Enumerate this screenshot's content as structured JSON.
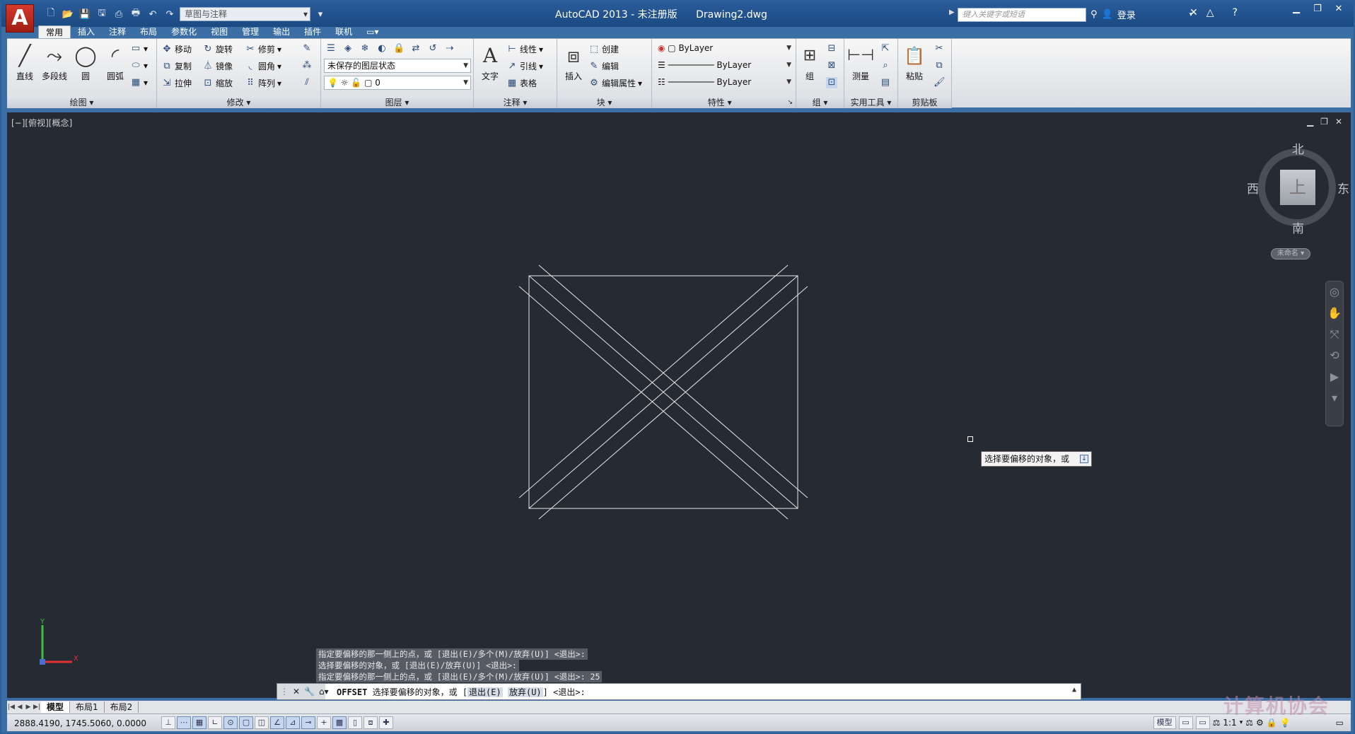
{
  "app": {
    "logo_letter": "A",
    "workspace": "草图与注释",
    "title": "AutoCAD 2013 - 未注册版",
    "document": "Drawing2.dwg",
    "search_placeholder": "键入关键字或短语",
    "login": "登录"
  },
  "tabs": [
    "常用",
    "插入",
    "注释",
    "布局",
    "参数化",
    "视图",
    "管理",
    "输出",
    "插件",
    "联机"
  ],
  "ribbon": {
    "draw": {
      "title": "绘图",
      "line": "直线",
      "polyline": "多段线",
      "circle": "圆",
      "arc": "圆弧"
    },
    "modify": {
      "title": "修改",
      "move": "移动",
      "rotate": "旋转",
      "trim": "修剪",
      "copy": "复制",
      "mirror": "镜像",
      "fillet": "圆角",
      "stretch": "拉伸",
      "scale": "缩放",
      "array": "阵列"
    },
    "layers": {
      "title": "图层",
      "state": "未保存的图层状态",
      "current_layer": "0"
    },
    "annotation": {
      "title": "注释",
      "text": "文字",
      "linear": "线性",
      "leader": "引线",
      "table": "表格"
    },
    "block": {
      "title": "块",
      "insert": "插入",
      "create": "创建",
      "edit": "编辑",
      "edit_attr": "编辑属性"
    },
    "properties": {
      "title": "特性",
      "color": "ByLayer",
      "linetype": "ByLayer",
      "lineweight": "ByLayer"
    },
    "groups": {
      "title": "组",
      "group": "组"
    },
    "utilities": {
      "title": "实用工具",
      "measure": "测量"
    },
    "clipboard": {
      "title": "剪贴板",
      "paste": "粘贴"
    }
  },
  "viewport": {
    "label": "[−][俯视][概念]",
    "viewcube": {
      "north": "北",
      "south": "南",
      "east": "东",
      "west": "西",
      "face": "上"
    },
    "wcs": "未命名"
  },
  "tooltip": "选择要偏移的对象，或",
  "command_history": [
    "指定要偏移的那一侧上的点，或 [退出(E)/多个(M)/放弃(U)] <退出>:",
    "选择要偏移的对象，或 [退出(E)/放弃(U)] <退出>:",
    "指定要偏移的那一侧上的点，或 [退出(E)/多个(M)/放弃(U)] <退出>:  25"
  ],
  "command_line": {
    "command": "OFFSET",
    "prompt": "选择要偏移的对象，或 [",
    "option1": "退出(E)",
    "option2": "放弃(U)",
    "suffix": "] <退出>:"
  },
  "layout_tabs": [
    "模型",
    "布局1",
    "布局2"
  ],
  "status": {
    "coords": "2888.4190,  1745.5060,  0.0000",
    "model": "模型",
    "scale": "1:1"
  },
  "watermark": "计算机协会"
}
